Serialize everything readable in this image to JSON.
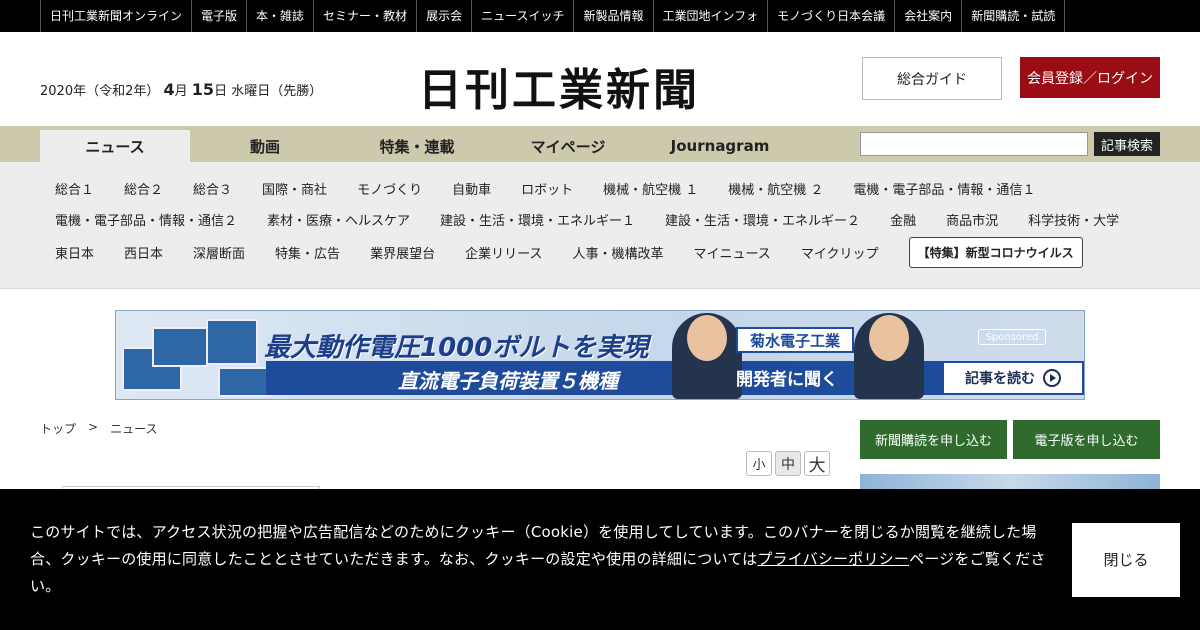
{
  "top_links": [
    "日刊工業新聞オンライン",
    "電子版",
    "本・雑誌",
    "セミナー・教材",
    "展示会",
    "ニュースイッチ",
    "新製品情報",
    "工業団地インフォ",
    "モノづくり日本会議",
    "会社案内",
    "新聞購読・試読"
  ],
  "header": {
    "date_prefix": "2020年（令和2年）",
    "month": "4",
    "month_unit": "月",
    "day": "15",
    "day_unit": "日",
    "date_suffix": "水曜日（先勝）",
    "logo": "日刊工業新聞",
    "guide_label": "総合ガイド",
    "login_label": "会員登録／ログイン"
  },
  "main_nav": {
    "tabs": [
      "ニュース",
      "動画",
      "特集・連載",
      "マイページ",
      "Journagram"
    ],
    "active_tab": "ニュース",
    "search_button": "記事検索",
    "search_value": ""
  },
  "sub_nav": {
    "row1": [
      "総合１",
      "総合２",
      "総合３",
      "国際・商社",
      "モノづくり",
      "自動車",
      "ロボット",
      "機械・航空機 １",
      "機械・航空機 ２",
      "電機・電子部品・情報・通信１"
    ],
    "row2": [
      "電機・電子部品・情報・通信２",
      "素材・医療・ヘルスケア",
      "建設・生活・環境・エネルギー１",
      "建設・生活・環境・エネルギー２",
      "金融",
      "商品市況",
      "科学技術・大学"
    ],
    "row3": [
      "東日本",
      "西日本",
      "深層断面",
      "特集・広告",
      "業界展望台",
      "企業リリース",
      "人事・機構改革",
      "マイニュース",
      "マイクリップ"
    ],
    "special_button": "【特集】新型コロナウイルス"
  },
  "ad": {
    "headline": "最大動作電圧1000ボルトを実現",
    "subline": "直流電子負荷装置５機種",
    "company": "菊水電子工業",
    "interview": "開発者に聞く",
    "sponsored": "Sponsored",
    "read_more": "記事を読む"
  },
  "breadcrumb": {
    "top": "トップ",
    "separator": ">",
    "current": "ニュース"
  },
  "font_size_buttons": [
    "小",
    "中",
    "大"
  ],
  "side_buttons": {
    "subscribe": "新聞購読を申し込む",
    "digital": "電子版を申し込む"
  },
  "cookie": {
    "text_before": "このサイトでは、アクセス状況の把握や広告配信などのためにクッキー（Cookie）を使用してしています。このバナーを閉じるか閲覧を継続した場合、クッキーの使用に同意したこととさせていただきます。なお、クッキーの設定や使用の詳細については",
    "link_text": "プライバシーポリシー",
    "text_after": "ページをご覧ください。",
    "close_label": "閉じる"
  }
}
